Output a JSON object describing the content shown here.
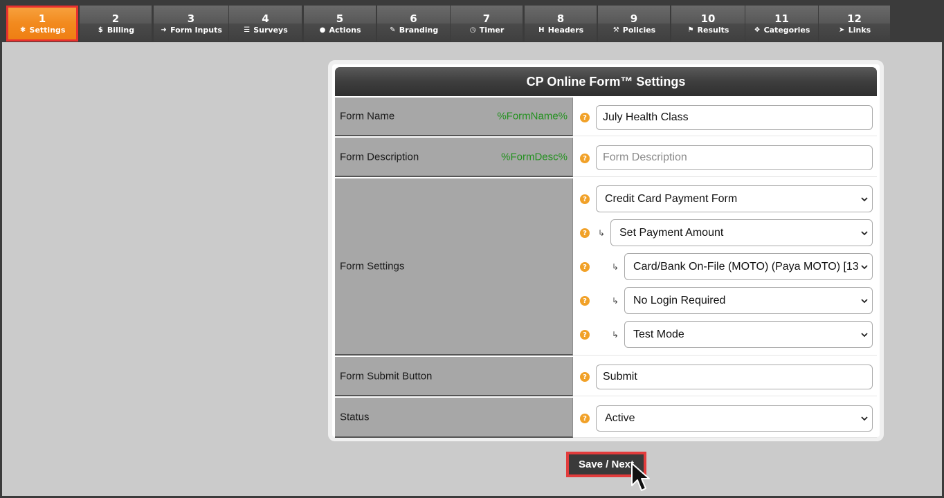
{
  "tabs": [
    {
      "num": "1",
      "label": "Settings",
      "icon": "gear-icon"
    },
    {
      "num": "2",
      "label": "Billing",
      "icon": "dollar-icon"
    },
    {
      "num": "3",
      "label": "Form Inputs",
      "icon": "sign-in-icon"
    },
    {
      "num": "4",
      "label": "Surveys",
      "icon": "list-icon"
    },
    {
      "num": "5",
      "label": "Actions",
      "icon": "user-icon"
    },
    {
      "num": "6",
      "label": "Branding",
      "icon": "brush-icon"
    },
    {
      "num": "7",
      "label": "Timer",
      "icon": "clock-icon"
    },
    {
      "num": "8",
      "label": "Headers",
      "icon": "header-icon"
    },
    {
      "num": "9",
      "label": "Policies",
      "icon": "gavel-icon"
    },
    {
      "num": "10",
      "label": "Results",
      "icon": "flag-icon"
    },
    {
      "num": "11",
      "label": "Categories",
      "icon": "cubes-icon"
    },
    {
      "num": "12",
      "label": "Links",
      "icon": "pointer-icon"
    }
  ],
  "active_tab": "1",
  "panel": {
    "title": "CP Online Form™ Settings",
    "help_glyph": "?",
    "sub_arrow": "↳",
    "form_name": {
      "label": "Form Name",
      "token": "%FormName%",
      "value": "July Health Class"
    },
    "form_description": {
      "label": "Form Description",
      "token": "%FormDesc%",
      "placeholder": "Form Description"
    },
    "form_settings": {
      "label": "Form Settings",
      "form_type": "Credit Card Payment Form",
      "payment_amount": "Set Payment Amount",
      "gateway": "Card/Bank On-File (MOTO) (Paya MOTO) [13",
      "login": "No Login Required",
      "mode": "Test Mode"
    },
    "submit_button": {
      "label": "Form Submit Button",
      "value": "Submit"
    },
    "status": {
      "label": "Status",
      "value": "Active"
    }
  },
  "save_next": {
    "label": "Save / Next"
  },
  "colors": {
    "active_tab": "#f28a1e",
    "active_outline": "#e8312f",
    "token_green": "#23911f",
    "help_orange": "#f1a128"
  }
}
